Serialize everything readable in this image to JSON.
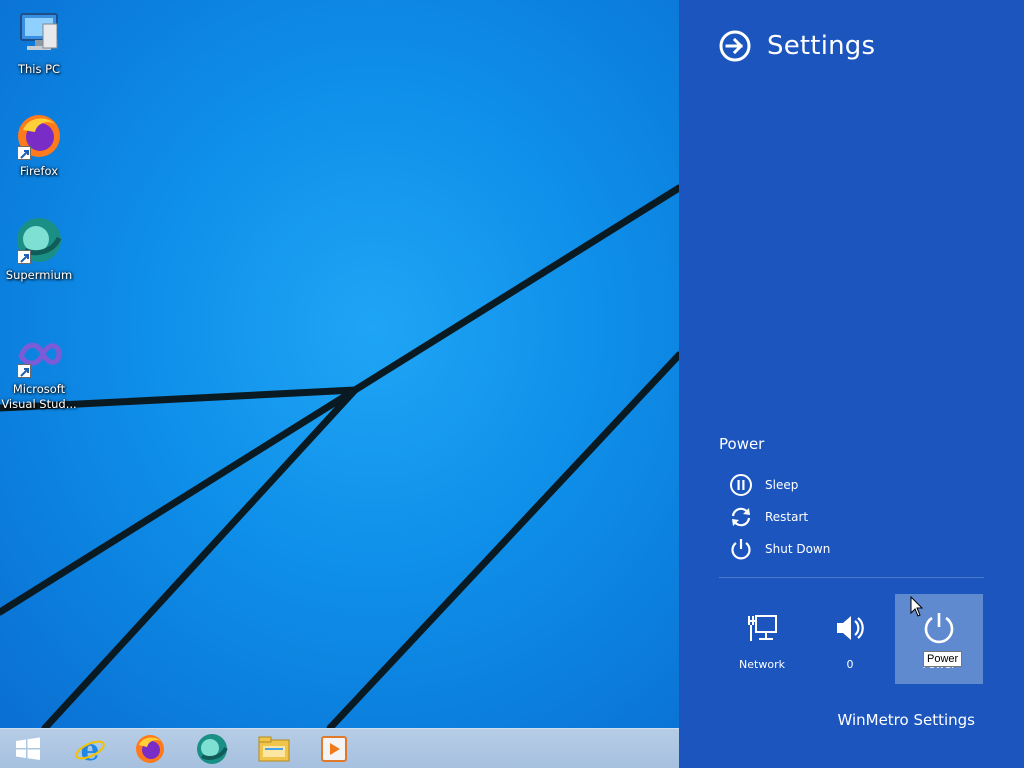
{
  "desktop": {
    "icons": [
      {
        "label": "This PC",
        "icon": "this-pc-icon"
      },
      {
        "label": "Firefox",
        "icon": "firefox-icon"
      },
      {
        "label": "Supermium",
        "icon": "supermium-icon"
      },
      {
        "label": "Microsoft Visual Stud...",
        "icon": "visual-studio-icon"
      }
    ]
  },
  "taskbar": {
    "buttons": [
      {
        "icon": "windows-start-icon"
      },
      {
        "icon": "internet-explorer-icon"
      },
      {
        "icon": "firefox-icon"
      },
      {
        "icon": "supermium-icon"
      },
      {
        "icon": "file-explorer-icon"
      },
      {
        "icon": "media-player-icon"
      }
    ]
  },
  "charms": {
    "title": "Settings",
    "power_heading": "Power",
    "power_items": [
      {
        "label": "Sleep",
        "icon": "sleep-icon"
      },
      {
        "label": "Restart",
        "icon": "restart-icon"
      },
      {
        "label": "Shut Down",
        "icon": "shutdown-icon"
      }
    ],
    "tiles": [
      {
        "label": "Network",
        "icon": "network-icon"
      },
      {
        "label": "0",
        "icon": "volume-icon"
      },
      {
        "label": "Power",
        "icon": "power-icon"
      }
    ],
    "tooltip": "Power",
    "footer_link": "WinMetro Settings"
  },
  "colors": {
    "charms_background": "#1b55bd",
    "desktop_background": "#0e8ee8",
    "taskbar": "#b0c8e4",
    "power_tile_highlight": "#5f8ad0"
  }
}
